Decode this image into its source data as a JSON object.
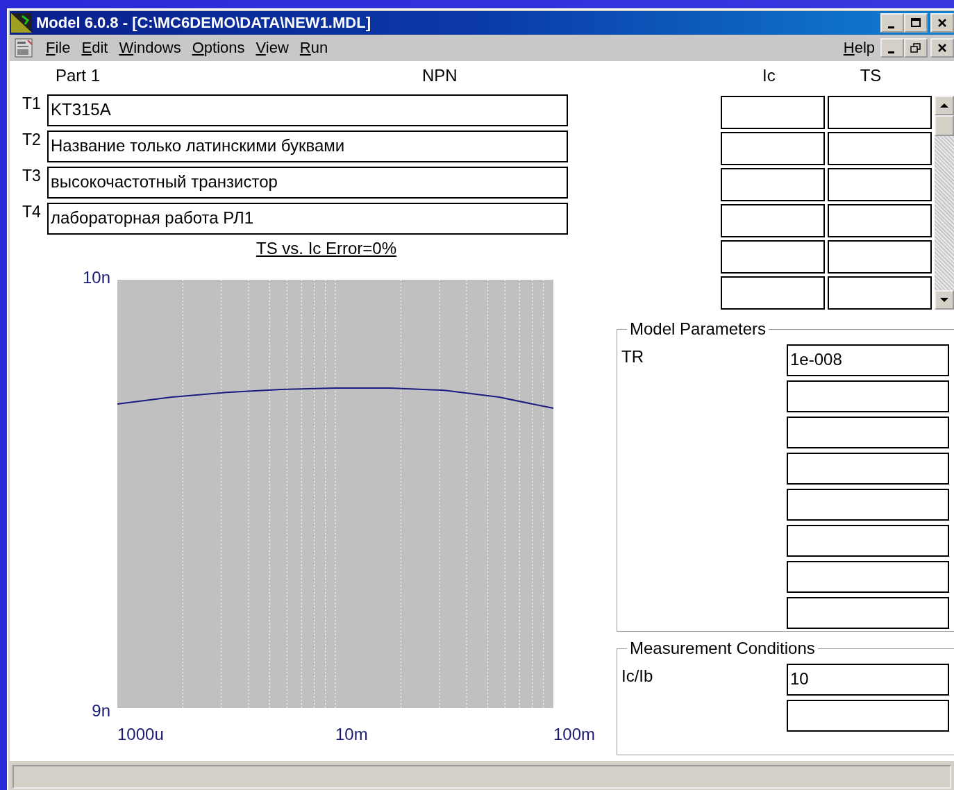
{
  "window": {
    "title": "Model 6.0.8 - [C:\\MC6DEMO\\DATA\\NEW1.MDL]"
  },
  "menu": [
    {
      "label": "File"
    },
    {
      "label": "Edit"
    },
    {
      "label": "Windows"
    },
    {
      "label": "Options"
    },
    {
      "label": "View"
    },
    {
      "label": "Run"
    }
  ],
  "help_menu": {
    "label": "Help"
  },
  "part": {
    "label": "Part 1",
    "type": "NPN"
  },
  "text_fields": [
    {
      "label": "T1",
      "value": "KT315A"
    },
    {
      "label": "T2",
      "value": "Название только латинскими буквами"
    },
    {
      "label": "T3",
      "value": "высокочастотный транзистор"
    },
    {
      "label": "T4",
      "value": "лабораторная работа РЛ1"
    }
  ],
  "chart": {
    "title": "TS vs. Ic Error=0%",
    "chart_data": {
      "type": "line",
      "categories": [
        "1000u",
        null,
        null,
        null,
        "10m",
        null,
        null,
        null,
        "100m"
      ],
      "series": [
        {
          "color": "#1a1a80",
          "values": [
            9.71,
            9.726,
            9.737,
            9.744,
            9.747,
            9.747,
            9.742,
            9.726,
            9.7
          ]
        }
      ],
      "ylim": [
        9,
        10
      ],
      "grid": "x",
      "yticks": [
        {
          "value": 9,
          "label": "9n"
        },
        {
          "value": 10,
          "label": "10n"
        }
      ]
    }
  },
  "data_table": {
    "columns": [
      "Ic",
      "TS"
    ]
  },
  "model_parameters": {
    "title": "Model Parameters",
    "fields": [
      {
        "label": "TR",
        "value": "1e-008"
      }
    ]
  },
  "measurement_conditions": {
    "title": "Measurement Conditions",
    "fields": [
      {
        "label": "Ic/Ib",
        "value": "10"
      }
    ]
  }
}
